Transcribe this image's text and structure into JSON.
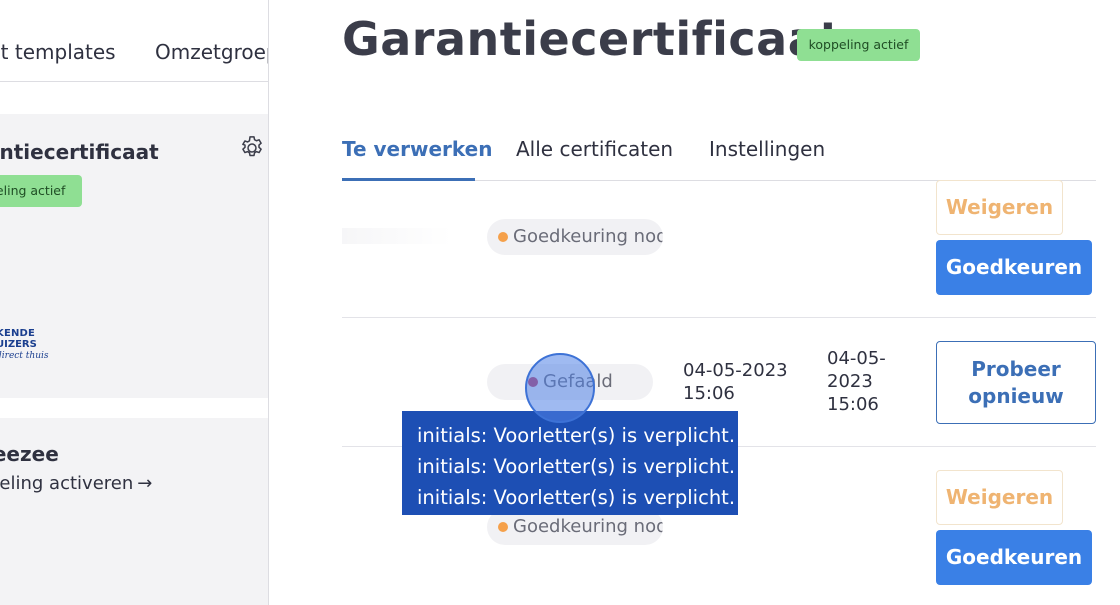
{
  "left": {
    "top_tabs": [
      "nt templates",
      "Omzetgroep"
    ],
    "cards": [
      {
        "title": "antiecertificaat",
        "badge": "peling actief",
        "logo": {
          "line1": "KENDE",
          "line2": "UIZERS",
          "tagline": "direct thuis"
        }
      },
      {
        "title": "leezee",
        "link": "peling activeren",
        "arrow": "→"
      }
    ]
  },
  "main": {
    "title": "Garantiecertificaat",
    "badge": "koppeling actief",
    "tabs": [
      {
        "label": "Te verwerken",
        "active": true
      },
      {
        "label": "Alle certificaten",
        "active": false
      },
      {
        "label": "Instellingen",
        "active": false
      }
    ],
    "rows": [
      {
        "status": "Goedkeuring nodi",
        "status_color": "#f5a04a",
        "buttons": [
          "Weigeren",
          "Goedkeuren"
        ]
      },
      {
        "status": "Gefaald",
        "status_color": "#c0395d",
        "date1_line1": "04-05-2023",
        "date1_line2": "15:06",
        "date2_line1": "04-05-",
        "date2_line2": "2023",
        "date2_line3": "15:06",
        "button_line1": "Probeer",
        "button_line2": "opnieuw"
      },
      {
        "status": "Goedkeuring nodi",
        "status_color": "#f5a04a",
        "buttons": [
          "Weigeren",
          "Goedkeuren"
        ]
      }
    ]
  },
  "tooltip": {
    "lines": [
      "initials: Voorletter(s) is verplicht.",
      "initials: Voorletter(s) is verplicht.",
      "initials: Voorletter(s) is verplicht."
    ]
  },
  "colors": {
    "accent": "#3c6fb6",
    "approve": "#3a80e6",
    "badge": "#8fdf93",
    "warning": "#efb472",
    "tooltip": "#1d4fb4"
  }
}
